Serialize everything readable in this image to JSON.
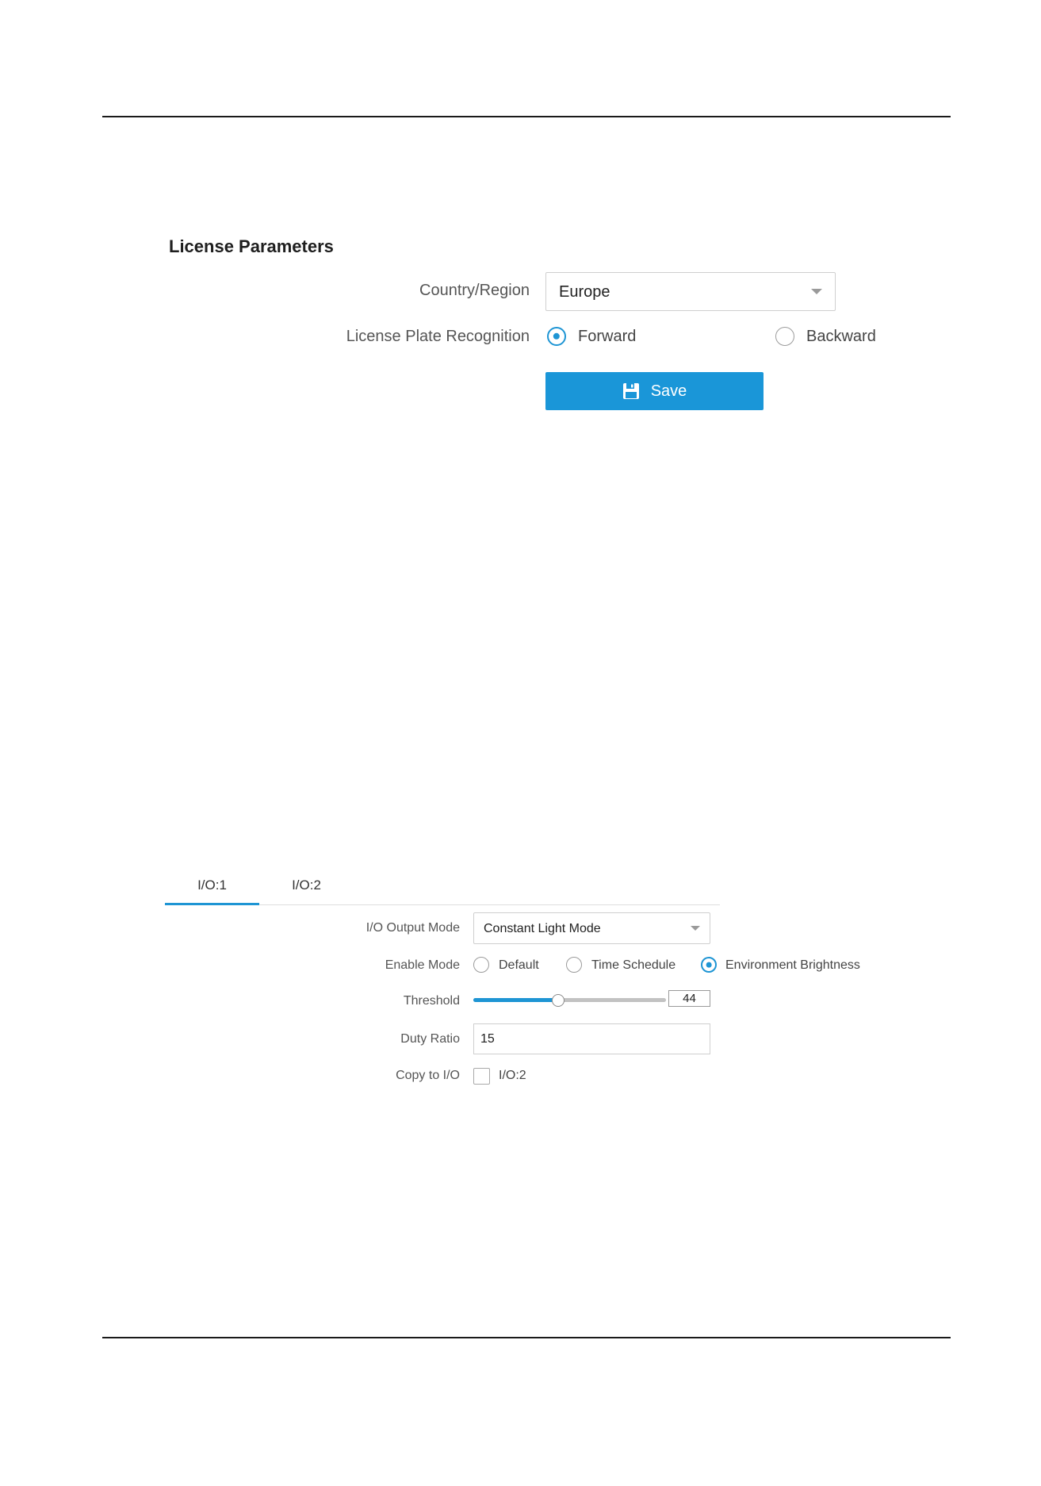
{
  "license_parameters": {
    "title": "License Parameters",
    "country_region": {
      "label": "Country/Region",
      "value": "Europe"
    },
    "recognition": {
      "label": "License Plate Recognition",
      "options": [
        {
          "label": "Forward",
          "selected": true
        },
        {
          "label": "Backward",
          "selected": false
        }
      ]
    },
    "save_label": "Save"
  },
  "io_panel": {
    "tabs": [
      {
        "label": "I/O:1",
        "active": true
      },
      {
        "label": "I/O:2",
        "active": false
      }
    ],
    "output_mode": {
      "label": "I/O Output Mode",
      "value": "Constant Light Mode"
    },
    "enable_mode": {
      "label": "Enable Mode",
      "options": [
        {
          "label": "Default",
          "selected": false
        },
        {
          "label": "Time Schedule",
          "selected": false
        },
        {
          "label": "Environment Brightness",
          "selected": true
        }
      ]
    },
    "threshold": {
      "label": "Threshold",
      "value": "44",
      "fraction": 0.44
    },
    "duty_ratio": {
      "label": "Duty Ratio",
      "value": "15"
    },
    "copy_to": {
      "label": "Copy to I/O",
      "option_label": "I/O:2",
      "checked": false
    }
  },
  "colors": {
    "accent": "#1e95d4",
    "button": "#1a96d8"
  }
}
